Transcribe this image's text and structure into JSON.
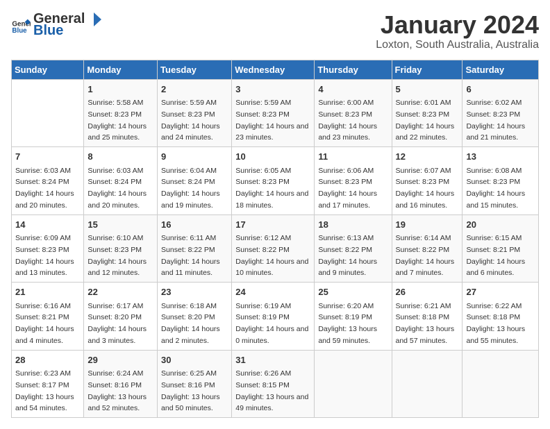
{
  "header": {
    "logo_general": "General",
    "logo_blue": "Blue",
    "title": "January 2024",
    "subtitle": "Loxton, South Australia, Australia"
  },
  "days_of_week": [
    "Sunday",
    "Monday",
    "Tuesday",
    "Wednesday",
    "Thursday",
    "Friday",
    "Saturday"
  ],
  "weeks": [
    [
      {
        "day": "",
        "sunrise": "",
        "sunset": "",
        "daylight": ""
      },
      {
        "day": "1",
        "sunrise": "5:58 AM",
        "sunset": "8:23 PM",
        "daylight": "14 hours and 25 minutes."
      },
      {
        "day": "2",
        "sunrise": "5:59 AM",
        "sunset": "8:23 PM",
        "daylight": "14 hours and 24 minutes."
      },
      {
        "day": "3",
        "sunrise": "5:59 AM",
        "sunset": "8:23 PM",
        "daylight": "14 hours and 23 minutes."
      },
      {
        "day": "4",
        "sunrise": "6:00 AM",
        "sunset": "8:23 PM",
        "daylight": "14 hours and 23 minutes."
      },
      {
        "day": "5",
        "sunrise": "6:01 AM",
        "sunset": "8:23 PM",
        "daylight": "14 hours and 22 minutes."
      },
      {
        "day": "6",
        "sunrise": "6:02 AM",
        "sunset": "8:23 PM",
        "daylight": "14 hours and 21 minutes."
      }
    ],
    [
      {
        "day": "7",
        "sunrise": "6:03 AM",
        "sunset": "8:24 PM",
        "daylight": "14 hours and 20 minutes."
      },
      {
        "day": "8",
        "sunrise": "6:03 AM",
        "sunset": "8:24 PM",
        "daylight": "14 hours and 20 minutes."
      },
      {
        "day": "9",
        "sunrise": "6:04 AM",
        "sunset": "8:24 PM",
        "daylight": "14 hours and 19 minutes."
      },
      {
        "day": "10",
        "sunrise": "6:05 AM",
        "sunset": "8:23 PM",
        "daylight": "14 hours and 18 minutes."
      },
      {
        "day": "11",
        "sunrise": "6:06 AM",
        "sunset": "8:23 PM",
        "daylight": "14 hours and 17 minutes."
      },
      {
        "day": "12",
        "sunrise": "6:07 AM",
        "sunset": "8:23 PM",
        "daylight": "14 hours and 16 minutes."
      },
      {
        "day": "13",
        "sunrise": "6:08 AM",
        "sunset": "8:23 PM",
        "daylight": "14 hours and 15 minutes."
      }
    ],
    [
      {
        "day": "14",
        "sunrise": "6:09 AM",
        "sunset": "8:23 PM",
        "daylight": "14 hours and 13 minutes."
      },
      {
        "day": "15",
        "sunrise": "6:10 AM",
        "sunset": "8:23 PM",
        "daylight": "14 hours and 12 minutes."
      },
      {
        "day": "16",
        "sunrise": "6:11 AM",
        "sunset": "8:22 PM",
        "daylight": "14 hours and 11 minutes."
      },
      {
        "day": "17",
        "sunrise": "6:12 AM",
        "sunset": "8:22 PM",
        "daylight": "14 hours and 10 minutes."
      },
      {
        "day": "18",
        "sunrise": "6:13 AM",
        "sunset": "8:22 PM",
        "daylight": "14 hours and 9 minutes."
      },
      {
        "day": "19",
        "sunrise": "6:14 AM",
        "sunset": "8:22 PM",
        "daylight": "14 hours and 7 minutes."
      },
      {
        "day": "20",
        "sunrise": "6:15 AM",
        "sunset": "8:21 PM",
        "daylight": "14 hours and 6 minutes."
      }
    ],
    [
      {
        "day": "21",
        "sunrise": "6:16 AM",
        "sunset": "8:21 PM",
        "daylight": "14 hours and 4 minutes."
      },
      {
        "day": "22",
        "sunrise": "6:17 AM",
        "sunset": "8:20 PM",
        "daylight": "14 hours and 3 minutes."
      },
      {
        "day": "23",
        "sunrise": "6:18 AM",
        "sunset": "8:20 PM",
        "daylight": "14 hours and 2 minutes."
      },
      {
        "day": "24",
        "sunrise": "6:19 AM",
        "sunset": "8:19 PM",
        "daylight": "14 hours and 0 minutes."
      },
      {
        "day": "25",
        "sunrise": "6:20 AM",
        "sunset": "8:19 PM",
        "daylight": "13 hours and 59 minutes."
      },
      {
        "day": "26",
        "sunrise": "6:21 AM",
        "sunset": "8:18 PM",
        "daylight": "13 hours and 57 minutes."
      },
      {
        "day": "27",
        "sunrise": "6:22 AM",
        "sunset": "8:18 PM",
        "daylight": "13 hours and 55 minutes."
      }
    ],
    [
      {
        "day": "28",
        "sunrise": "6:23 AM",
        "sunset": "8:17 PM",
        "daylight": "13 hours and 54 minutes."
      },
      {
        "day": "29",
        "sunrise": "6:24 AM",
        "sunset": "8:16 PM",
        "daylight": "13 hours and 52 minutes."
      },
      {
        "day": "30",
        "sunrise": "6:25 AM",
        "sunset": "8:16 PM",
        "daylight": "13 hours and 50 minutes."
      },
      {
        "day": "31",
        "sunrise": "6:26 AM",
        "sunset": "8:15 PM",
        "daylight": "13 hours and 49 minutes."
      },
      {
        "day": "",
        "sunrise": "",
        "sunset": "",
        "daylight": ""
      },
      {
        "day": "",
        "sunrise": "",
        "sunset": "",
        "daylight": ""
      },
      {
        "day": "",
        "sunrise": "",
        "sunset": "",
        "daylight": ""
      }
    ]
  ]
}
